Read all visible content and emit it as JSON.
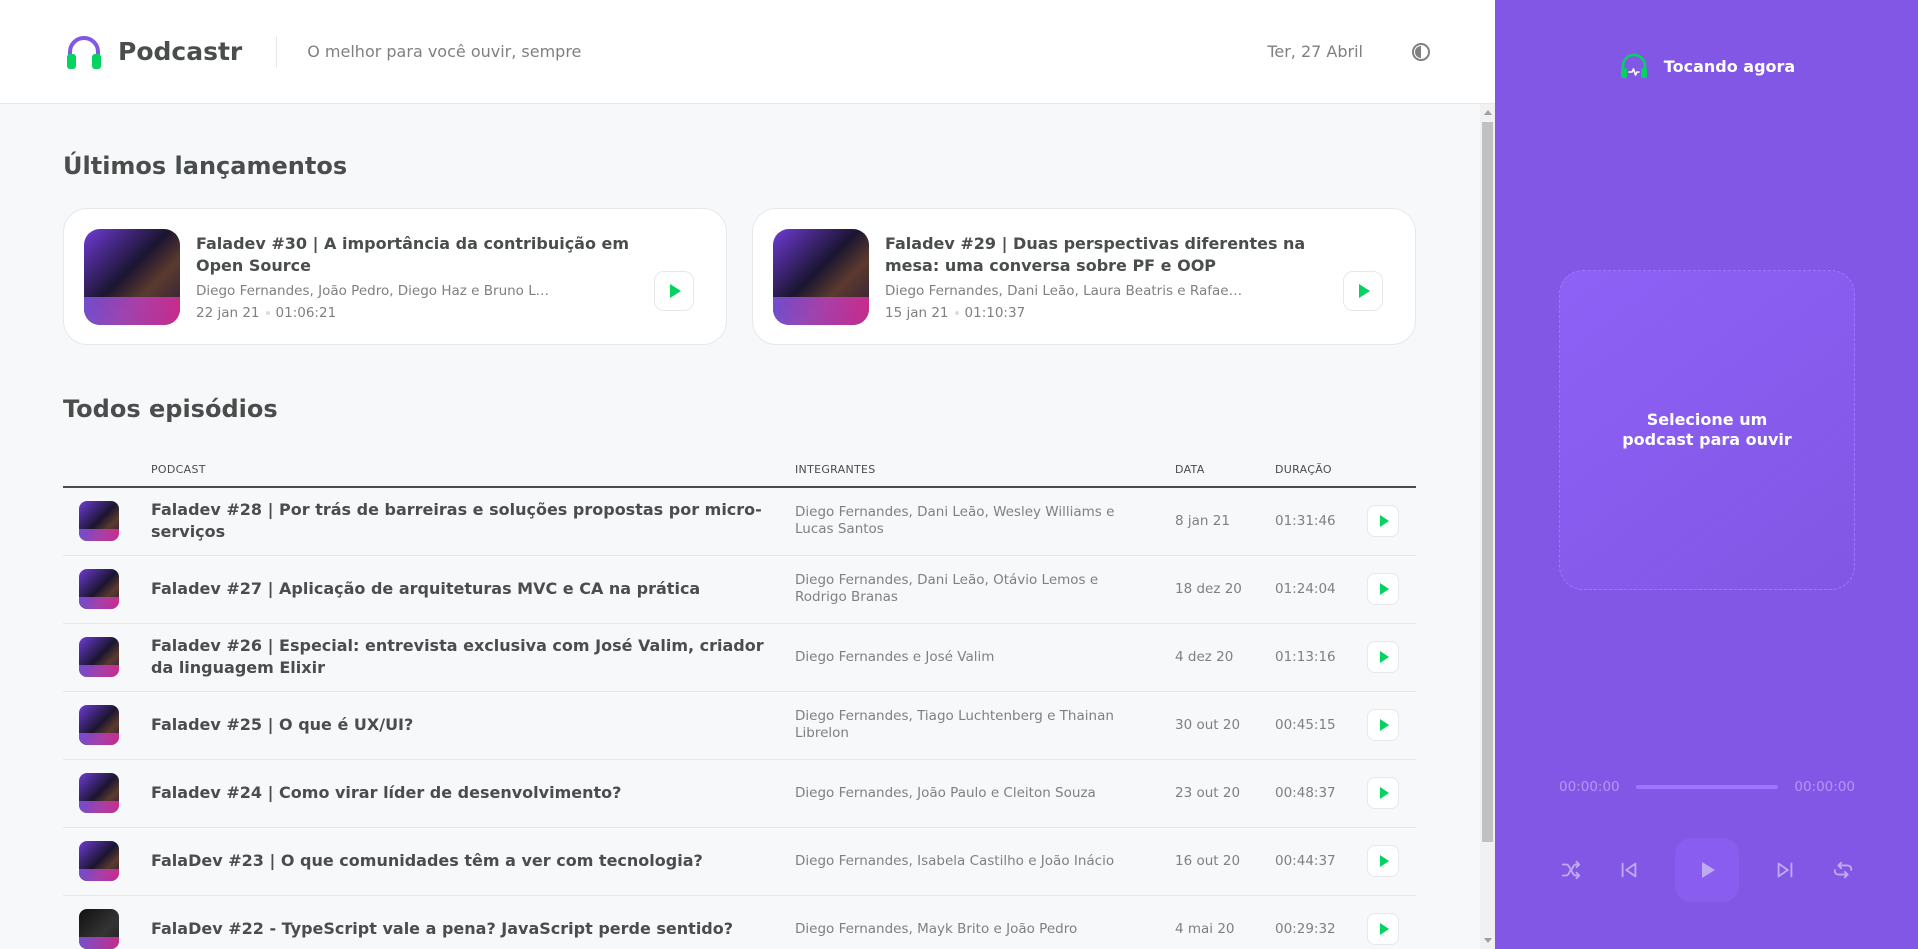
{
  "header": {
    "app_name": "Podcastr",
    "tagline": "O melhor para você ouvir, sempre",
    "date": "Ter, 27 Abril"
  },
  "latest": {
    "title": "Últimos lançamentos",
    "episodes": [
      {
        "title": "Faladev #30 | A importância da contribuição em Open Source",
        "members": "Diego Fernandes, João Pedro, Diego Haz e Bruno Le...",
        "date": "22 jan 21",
        "duration": "01:06:21"
      },
      {
        "title": "Faladev #29 | Duas perspectivas diferentes na mesa: uma conversa sobre PF e OOP",
        "members": "Diego Fernandes, Dani Leão, Laura Beatris e Rafael ...",
        "date": "15 jan 21",
        "duration": "01:10:37"
      }
    ]
  },
  "all": {
    "title": "Todos episódios",
    "columns": [
      "Podcast",
      "Integrantes",
      "Data",
      "Duração"
    ],
    "episodes": [
      {
        "title": "Faladev #28 | Por trás de barreiras e soluções propostas por micro-serviços",
        "members": "Diego Fernandes, Dani Leão, Wesley Williams e Lucas Santos",
        "date": "8 jan 21",
        "duration": "01:31:46"
      },
      {
        "title": "Faladev #27 | Aplicação de arquiteturas MVC e CA na prática",
        "members": "Diego Fernandes, Dani Leão, Otávio Lemos e Rodrigo Branas",
        "date": "18 dez 20",
        "duration": "01:24:04"
      },
      {
        "title": "Faladev #26 | Especial: entrevista exclusiva com José Valim, criador da linguagem Elixir",
        "members": "Diego Fernandes e José Valim",
        "date": "4 dez 20",
        "duration": "01:13:16"
      },
      {
        "title": "Faladev #25 | O que é UX/UI?",
        "members": "Diego Fernandes, Tiago Luchtenberg e Thainan Librelon",
        "date": "30 out 20",
        "duration": "00:45:15"
      },
      {
        "title": "Faladev #24 | Como virar líder de desenvolvimento?",
        "members": "Diego Fernandes, João Paulo e Cleiton Souza",
        "date": "23 out 20",
        "duration": "00:48:37"
      },
      {
        "title": "FalaDev #23 | O que comunidades têm a ver com tecnologia?",
        "members": "Diego Fernandes, Isabela Castilho e João Inácio",
        "date": "16 out 20",
        "duration": "00:44:37"
      },
      {
        "title": "FalaDev #22 - TypeScript vale a pena? JavaScript perde sentido?",
        "members": "Diego Fernandes, Mayk Brito e João Pedro",
        "date": "4 mai 20",
        "duration": "00:29:32"
      }
    ]
  },
  "player": {
    "heading": "Tocando agora",
    "empty_text": "Selecione um podcast para ouvir",
    "current_time": "00:00:00",
    "total_time": "00:00:00"
  },
  "colors": {
    "primary": "#8257e5",
    "accent_green": "#04d361",
    "text": "#494d4b",
    "muted": "#808080"
  },
  "icons": [
    "headphones-logo-icon",
    "theme-toggle-icon",
    "play-icon",
    "shuffle-icon",
    "previous-icon",
    "next-icon",
    "repeat-icon",
    "playing-now-icon"
  ]
}
